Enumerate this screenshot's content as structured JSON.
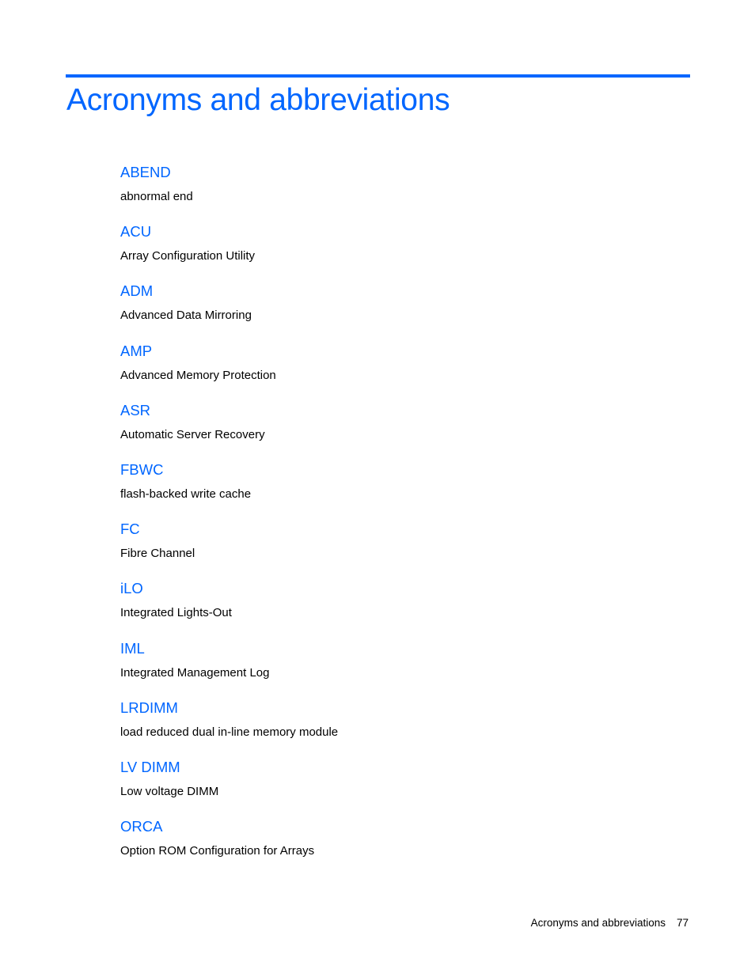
{
  "page": {
    "title": "Acronyms and abbreviations",
    "accent_color": "#0066ff"
  },
  "entries": [
    {
      "term": "ABEND",
      "definition": "abnormal end"
    },
    {
      "term": "ACU",
      "definition": "Array Configuration Utility"
    },
    {
      "term": "ADM",
      "definition": "Advanced Data Mirroring"
    },
    {
      "term": "AMP",
      "definition": "Advanced Memory Protection"
    },
    {
      "term": "ASR",
      "definition": "Automatic Server Recovery"
    },
    {
      "term": "FBWC",
      "definition": "flash-backed write cache"
    },
    {
      "term": "FC",
      "definition": "Fibre Channel"
    },
    {
      "term": "iLO",
      "definition": "Integrated Lights-Out"
    },
    {
      "term": "IML",
      "definition": "Integrated Management Log"
    },
    {
      "term": "LRDIMM",
      "definition": "load reduced dual in-line memory module"
    },
    {
      "term": "LV DIMM",
      "definition": "Low voltage DIMM"
    },
    {
      "term": "ORCA",
      "definition": "Option ROM Configuration for Arrays"
    }
  ],
  "footer": {
    "section": "Acronyms and abbreviations",
    "page_number": "77"
  }
}
